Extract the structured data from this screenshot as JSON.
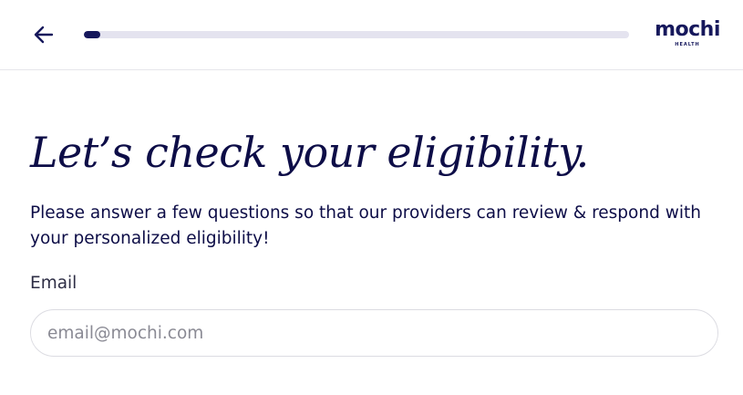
{
  "header": {
    "back_icon": "arrow-left-icon",
    "progress": 0.03,
    "logo": {
      "name": "mochi",
      "tagline": "HEALTH"
    }
  },
  "main": {
    "title": "Let’s check your eligibility.",
    "subtitle": "Please answer a few questions so that our providers can review & respond with your personalized eligibility!",
    "email_label": "Email",
    "email_placeholder": "email@mochi.com",
    "email_value": ""
  },
  "colors": {
    "brand": "#16185c",
    "progress_track": "#e4e3ef",
    "text": "#0d0d47"
  }
}
